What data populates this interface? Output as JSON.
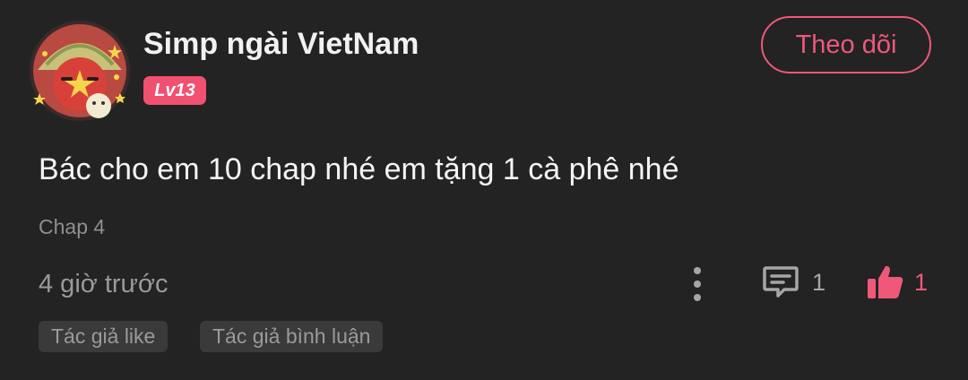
{
  "comment": {
    "username": "Simp ngài VietNam",
    "level": "Lv13",
    "follow_label": "Theo dõi",
    "text": "Bác cho em 10 chap nhé em tặng 1 cà phê nhé",
    "chapter": "Chap 4",
    "time": "4 giờ trước",
    "reply_count": "1",
    "like_count": "1",
    "tags": [
      "Tác giả like",
      "Tác giả bình luận"
    ]
  },
  "icons": {
    "more": "more-vertical-icon",
    "reply": "comment-icon",
    "like": "thumbs-up-icon"
  },
  "colors": {
    "background": "#232323",
    "accent": "#f0587a",
    "badge": "#f25070",
    "muted_text": "#9a9a9a",
    "tag_background": "#3a3a3a"
  }
}
